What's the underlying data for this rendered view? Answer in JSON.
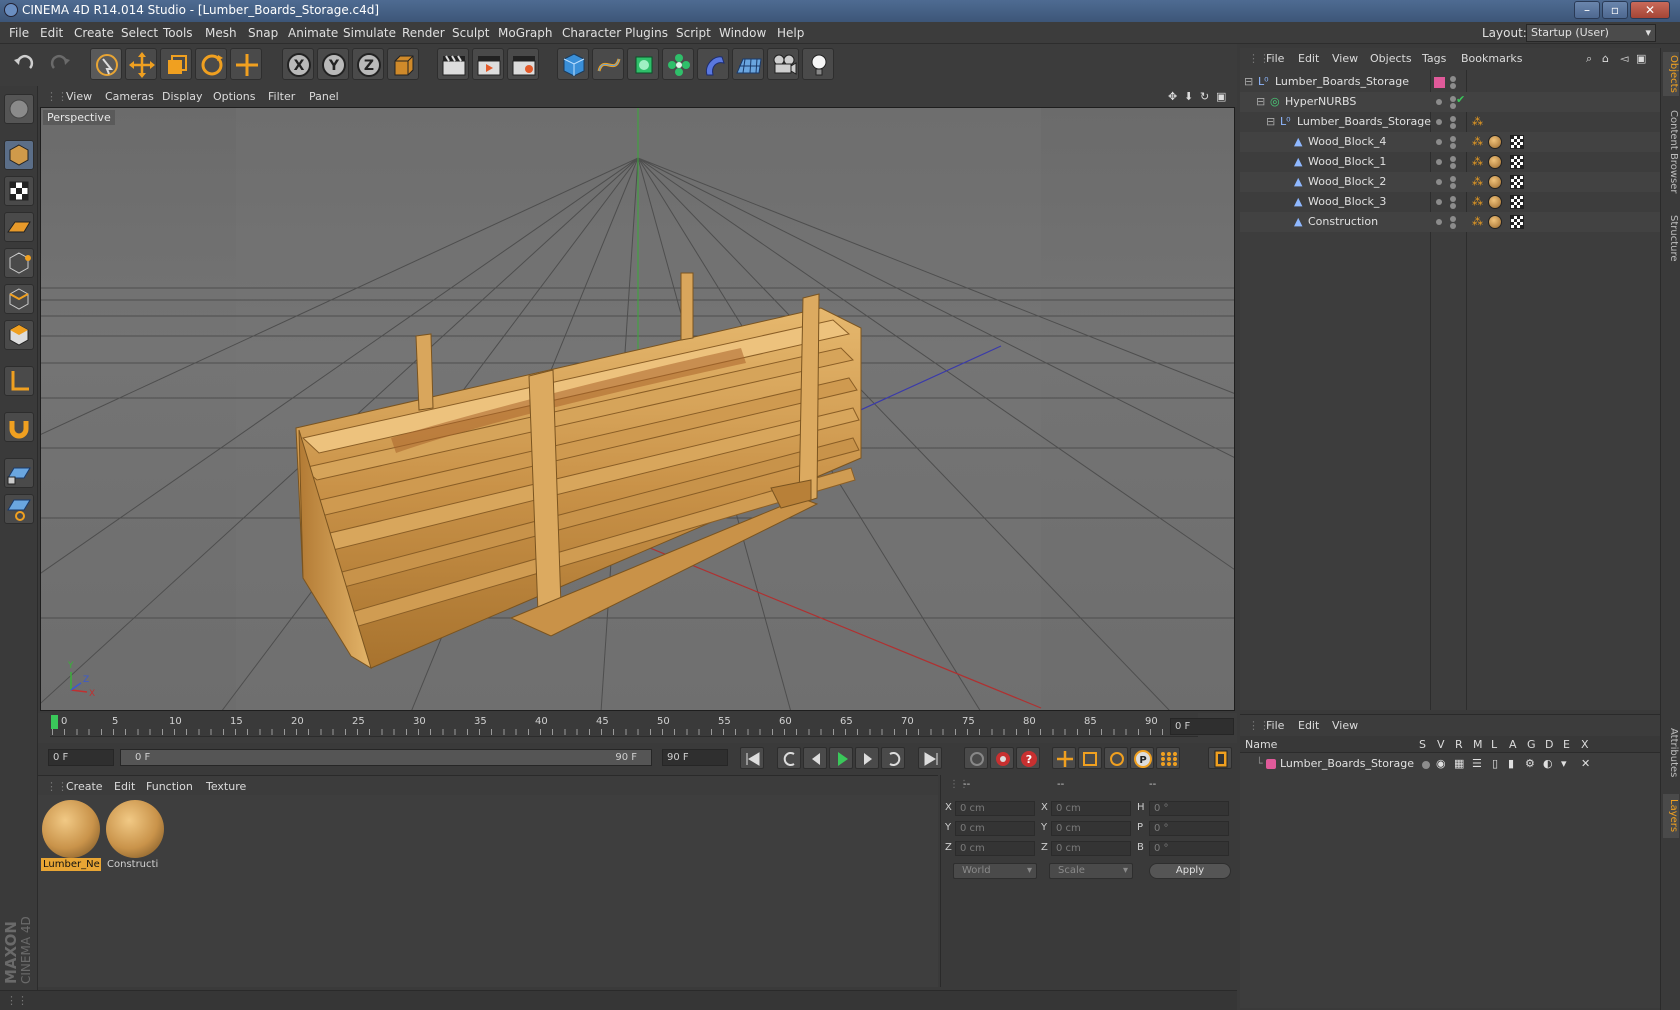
{
  "window": {
    "title": "CINEMA 4D R14.014 Studio - [Lumber_Boards_Storage.c4d]"
  },
  "menubar": [
    "File",
    "Edit",
    "Create",
    "Select",
    "Tools",
    "Mesh",
    "Snap",
    "Animate",
    "Simulate",
    "Render",
    "Sculpt",
    "MoGraph",
    "Character",
    "Plugins",
    "Script",
    "Window",
    "Help"
  ],
  "layout": {
    "label": "Layout:",
    "value": "Startup (User)"
  },
  "viewport": {
    "menu": [
      "View",
      "Cameras",
      "Display",
      "Options",
      "Filter",
      "Panel"
    ],
    "label": "Perspective"
  },
  "timeline": {
    "ticks": [
      "0",
      "5",
      "10",
      "15",
      "20",
      "25",
      "30",
      "35",
      "40",
      "45",
      "50",
      "55",
      "60",
      "65",
      "70",
      "75",
      "80",
      "85",
      "90"
    ],
    "current_frame": "0 F",
    "start_field": "0 F",
    "range_start": "0 F",
    "range_end": "90 F",
    "end_field": "90 F"
  },
  "materials": {
    "menu": [
      "Create",
      "Edit",
      "Function",
      "Texture"
    ],
    "items": [
      {
        "name": "Lumber_Ne",
        "selected": true
      },
      {
        "name": "Constructi",
        "selected": false
      }
    ]
  },
  "coords": {
    "headers": [
      "--",
      "--",
      "--"
    ],
    "rows": [
      {
        "l1": "X",
        "v1": "0 cm",
        "l2": "X",
        "v2": "0 cm",
        "l3": "H",
        "v3": "0 °"
      },
      {
        "l1": "Y",
        "v1": "0 cm",
        "l2": "Y",
        "v2": "0 cm",
        "l3": "P",
        "v3": "0 °"
      },
      {
        "l1": "Z",
        "v1": "0 cm",
        "l2": "Z",
        "v2": "0 cm",
        "l3": "B",
        "v3": "0 °"
      }
    ],
    "mode": "World",
    "scale": "Scale",
    "apply": "Apply"
  },
  "objects": {
    "menu": [
      "File",
      "Edit",
      "View",
      "Objects",
      "Tags",
      "Bookmarks"
    ],
    "items": [
      {
        "name": "Lumber_Boards_Storage"
      },
      {
        "name": "HyperNURBS"
      },
      {
        "name": "Lumber_Boards_Storage"
      },
      {
        "name": "Wood_Block_4"
      },
      {
        "name": "Wood_Block_1"
      },
      {
        "name": "Wood_Block_2"
      },
      {
        "name": "Wood_Block_3"
      },
      {
        "name": "Construction"
      }
    ]
  },
  "layers": {
    "menu": [
      "File",
      "Edit",
      "View"
    ],
    "columns": [
      "Name",
      "S",
      "V",
      "R",
      "M",
      "L",
      "A",
      "G",
      "D",
      "E",
      "X"
    ],
    "items": [
      {
        "name": "Lumber_Boards_Storage",
        "color": "#e05a9a"
      }
    ]
  },
  "sidetabs": [
    "Objects",
    "Content Browser",
    "Structure",
    "Attributes",
    "Layers"
  ],
  "colors": {
    "accent": "#f0a020",
    "layer_pink": "#e05a9a",
    "selection": "#e8a534"
  }
}
